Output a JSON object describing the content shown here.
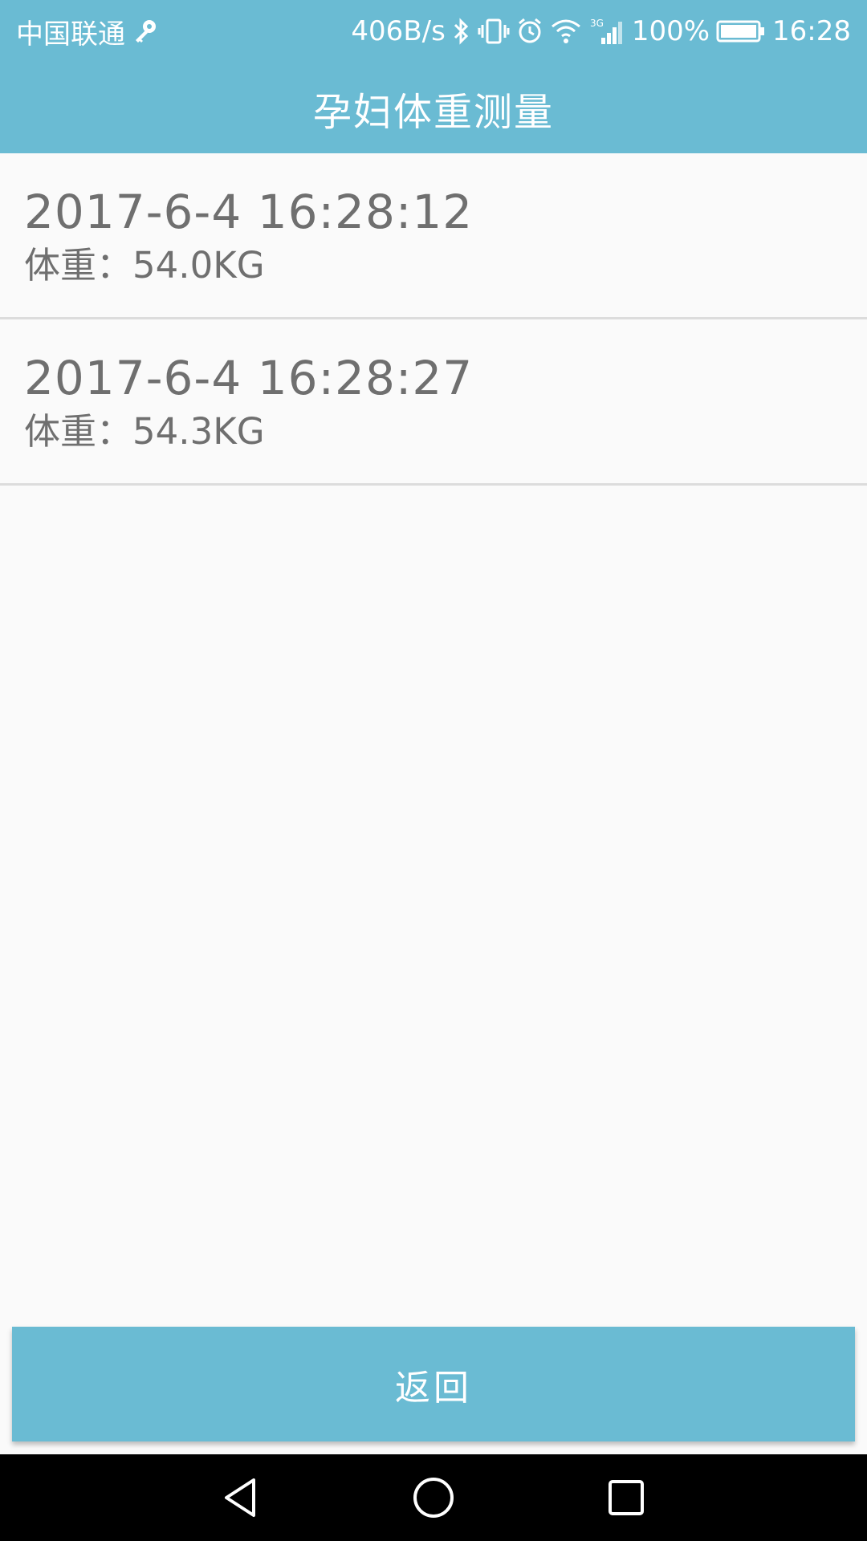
{
  "status_bar": {
    "carrier": "中国联通",
    "net_speed": "406B/s",
    "battery_percent": "100%",
    "time": "16:28",
    "icons": [
      "key-icon",
      "bluetooth-icon",
      "vibrate-icon",
      "alarm-icon",
      "wifi-icon",
      "signal-3g-icon",
      "battery-icon"
    ]
  },
  "header": {
    "title": "孕妇体重测量"
  },
  "records": [
    {
      "datetime": "2017-6-4 16:28:12",
      "weight": "体重：54.0KG"
    },
    {
      "datetime": "2017-6-4 16:28:27",
      "weight": "体重：54.3KG"
    }
  ],
  "back_button": {
    "label": "返回"
  },
  "nav_bar": {
    "icons": [
      "back-triangle-icon",
      "home-circle-icon",
      "recents-square-icon"
    ]
  },
  "colors": {
    "accent": "#6abbd3",
    "background": "#fafafa",
    "text": "#6f6f6f"
  }
}
